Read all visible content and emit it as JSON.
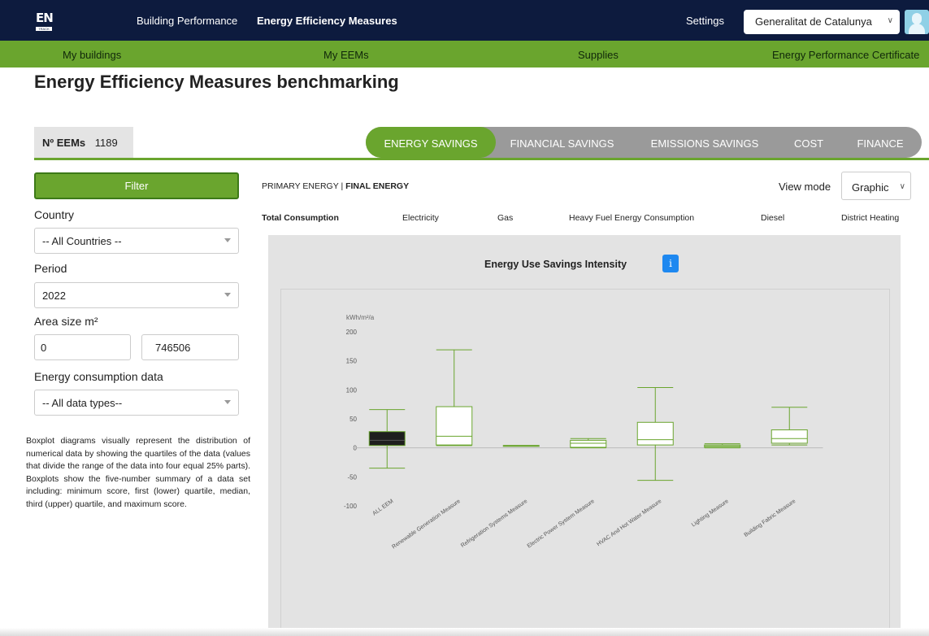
{
  "header": {
    "logo_text": "EN",
    "logo_sub": "TRACK",
    "nav": [
      "Building Performance",
      "Energy Efficiency Measures"
    ],
    "settings_label": "Settings",
    "organization": "Generalitat de Catalunya"
  },
  "subnav": {
    "items": [
      "My buildings",
      "My EEMs",
      "Supplies",
      "Energy Performance Certificate"
    ]
  },
  "page": {
    "title": "Energy Efficiency Measures benchmarking"
  },
  "summary": {
    "count_label": "Nº EEMs",
    "count_value": "1189"
  },
  "tabs": [
    "ENERGY SAVINGS",
    "FINANCIAL SAVINGS",
    "EMISSIONS SAVINGS",
    "COST",
    "FINANCE"
  ],
  "active_tab": "ENERGY SAVINGS",
  "filters": {
    "filter_button": "Filter",
    "country_label": "Country",
    "country_value": "-- All Countries --",
    "period_label": "Period",
    "period_value": "2022",
    "area_label": "Area size m²",
    "area_min": "0",
    "area_max": "746506",
    "energy_data_label": "Energy consumption data",
    "energy_data_value": "-- All data types--",
    "description": "Boxplot diagrams visually represent the distribution of numerical data by showing the quartiles of the data (values that divide the range of the data into four equal 25% parts). Boxplots show the five-number summary of a data set including: minimum score, first (lower) quartile, median, third (upper) quartile, and maximum score."
  },
  "toolbar": {
    "energy_primary": "PRIMARY ENERGY",
    "energy_separator": " | ",
    "energy_final": "FINAL ENERGY",
    "view_mode_label": "View mode",
    "view_mode_value": "Graphic"
  },
  "consumption_tabs": [
    "Total Consumption",
    "Electricity",
    "Gas",
    "Heavy Fuel Energy Consumption",
    "Diesel",
    "District Heating"
  ],
  "chart_title": "Energy Use Savings Intensity",
  "info_label": "i",
  "colors": {
    "navy": "#0d1b3e",
    "green": "#6aa52e",
    "tab_grey": "#9a9a9a",
    "info_blue": "#1e88f0",
    "box_dark": "#1e1e1e"
  },
  "chart_data": {
    "type": "boxplot",
    "title": "Energy Use Savings Intensity",
    "ylabel": "kWh/m²/a",
    "ylim": [
      -100,
      200
    ],
    "yticks": [
      200,
      150,
      100,
      50,
      0,
      -50,
      -100
    ],
    "categories": [
      "ALL EEM",
      "Renewable Generation Measure",
      "Refrigeration Systems Measure",
      "Electric Power System Measure",
      "HVAC And Hot Water Measure",
      "Lighting Measure",
      "Building Fabric Measure"
    ],
    "boxes": [
      {
        "min": -35,
        "q1": 4,
        "median": 13,
        "q3": 28,
        "max": 66
      },
      {
        "min": 4,
        "q1": 5,
        "median": 20,
        "q3": 71,
        "max": 169
      },
      {
        "min": 4,
        "q1": 4,
        "median": 4,
        "q3": 4,
        "max": 4
      },
      {
        "min": 0,
        "q1": 1,
        "median": 8,
        "q3": 13,
        "max": 16
      },
      {
        "min": -56,
        "q1": 5,
        "median": 14,
        "q3": 44,
        "max": 104
      },
      {
        "min": 0,
        "q1": 1,
        "median": 3,
        "q3": 5,
        "max": 7
      },
      {
        "min": 5,
        "q1": 8,
        "median": 16,
        "q3": 31,
        "max": 70
      }
    ],
    "grid": false,
    "legend": "none"
  }
}
